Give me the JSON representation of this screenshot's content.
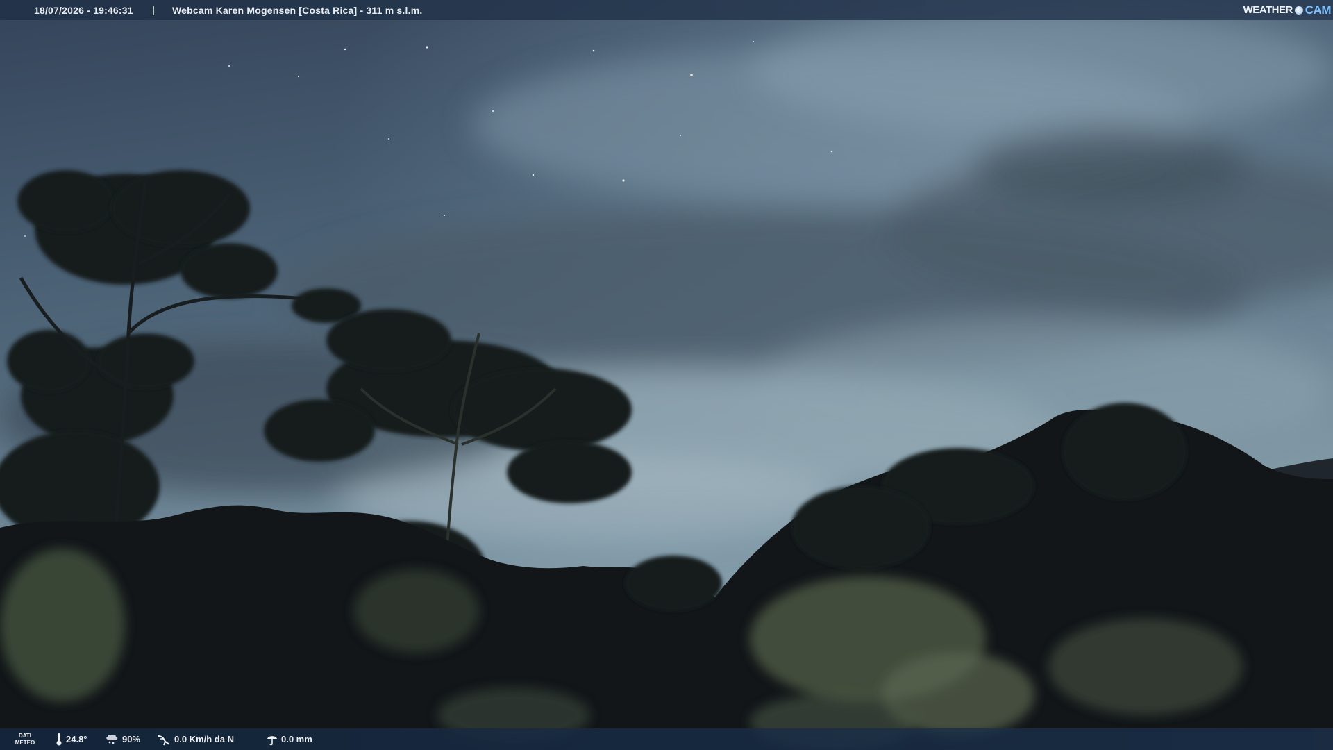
{
  "header": {
    "timestamp": "18/07/2026 - 19:46:31",
    "separator": "|",
    "title": "Webcam Karen Mogensen [Costa Rica] - 311 m s.l.m.",
    "brand_left": "WEATHER",
    "brand_right": "CAM"
  },
  "footer": {
    "label_line1": "DATI",
    "label_line2": "METEO",
    "temperature": "24.8°",
    "humidity": "90%",
    "wind": "0.0 Km/h da N",
    "rain": "0.0 mm"
  },
  "icons": [
    "thermometer-icon",
    "humidity-icon",
    "wind-icon",
    "rain-icon"
  ],
  "colors": {
    "sky_top": "#3c4d60",
    "sky_bottom": "#7f98a6",
    "foliage": "#12161a",
    "bar": "#213248",
    "brand_accent": "#7fc0ff"
  }
}
